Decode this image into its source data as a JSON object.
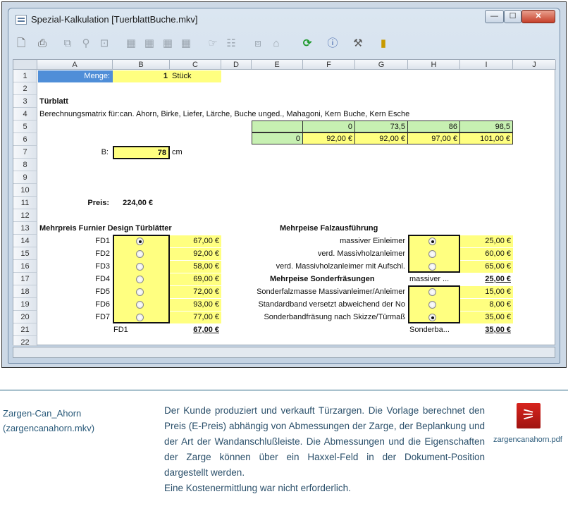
{
  "window": {
    "title": "Spezial-Kalkulation [TuerblattBuche.mkv]",
    "min": "—",
    "max": "☐",
    "close": "✕"
  },
  "columns": [
    "A",
    "B",
    "C",
    "D",
    "E",
    "F",
    "G",
    "H",
    "I",
    "J"
  ],
  "rows": [
    "1",
    "2",
    "3",
    "4",
    "5",
    "6",
    "7",
    "8",
    "9",
    "10",
    "11",
    "12",
    "13",
    "14",
    "15",
    "16",
    "17",
    "18",
    "19",
    "20",
    "21",
    "22"
  ],
  "cells": {
    "menge_label": "Menge:",
    "menge_value": "1",
    "menge_unit": "Stück",
    "tuerblatt": "Türblatt",
    "matrix": "Berechnungsmatrix für:can. Ahorn, Birke, Liefer, Lärche, Buche unged., Mahagoni, Kern Buche, Kern Esche",
    "row5": [
      "",
      "0",
      "73,5",
      "86",
      "98,5"
    ],
    "row6": [
      "0",
      "92,00 €",
      "92,00 €",
      "97,00 €",
      "101,00 €"
    ],
    "b_label": "B:",
    "b_value": "78",
    "b_unit": "cm",
    "preis_label": "Preis:",
    "preis_value": "224,00 €",
    "mehrpreis_title": "Mehrpreis Furnier Design Türblätter",
    "fd": [
      {
        "label": "FD1",
        "price": "67,00 €",
        "selected": true
      },
      {
        "label": "FD2",
        "price": "92,00 €",
        "selected": false
      },
      {
        "label": "FD3",
        "price": "58,00 €",
        "selected": false
      },
      {
        "label": "FD4",
        "price": "69,00 €",
        "selected": false
      },
      {
        "label": "FD5",
        "price": "72,00 €",
        "selected": false
      },
      {
        "label": "FD6",
        "price": "93,00 €",
        "selected": false
      },
      {
        "label": "FD7",
        "price": "77,00 €",
        "selected": false
      }
    ],
    "fd_result_label": "FD1",
    "fd_result_value": "67,00 €",
    "falz_title": "Mehrpeise Falzausführung",
    "falz": [
      {
        "label": "massiver Einleimer",
        "price": "25,00 €",
        "selected": true
      },
      {
        "label": "verd. Massivholzanleimer",
        "price": "60,00 €",
        "selected": false
      },
      {
        "label": "verd. Massivholzanleimer mit Aufschl.",
        "price": "65,00 €",
        "selected": false
      }
    ],
    "sonder_title": "Mehrpeise Sonderfräsungen",
    "sonder_sel": "massiver ...",
    "sonder_sel_value": "25,00 €",
    "sonder": [
      {
        "label": "Sonderfalzmasse Massivanleimer/Anleimer",
        "price": "15,00 €",
        "selected": false
      },
      {
        "label": "Standardband versetzt abweichend der No",
        "price": "8,00 €",
        "selected": false
      },
      {
        "label": "Sonderbandfräsung nach Skizze/Türmaß",
        "price": "35,00 €",
        "selected": true
      }
    ],
    "sonder_result_label": "Sonderba...",
    "sonder_result_value": "35,00 €"
  },
  "caption": {
    "name": "Zargen-Can_Ahorn",
    "file": "(zargencanahorn.mkv)",
    "description": "Der Kunde produziert und verkauft Türzargen. Die Vorlage berechnet den Preis (E-Preis) abhängig von Abmessungen der Zarge, der Beplankung und der Art der Wandanschlußleiste. Die Abmessungen und die Eigenschaften der Zarge können über ein Haxxel-Feld in der Dokument-Position dargestellt werden.",
    "description2": "Eine Kostenermittlung war nicht erforderlich.",
    "pdf": "zargencanahorn.pdf"
  },
  "colors": {
    "accent": "#4f8ed8",
    "yellow": "#ffff80",
    "green": "#c7f0b2",
    "pdf": "#c41e17"
  }
}
